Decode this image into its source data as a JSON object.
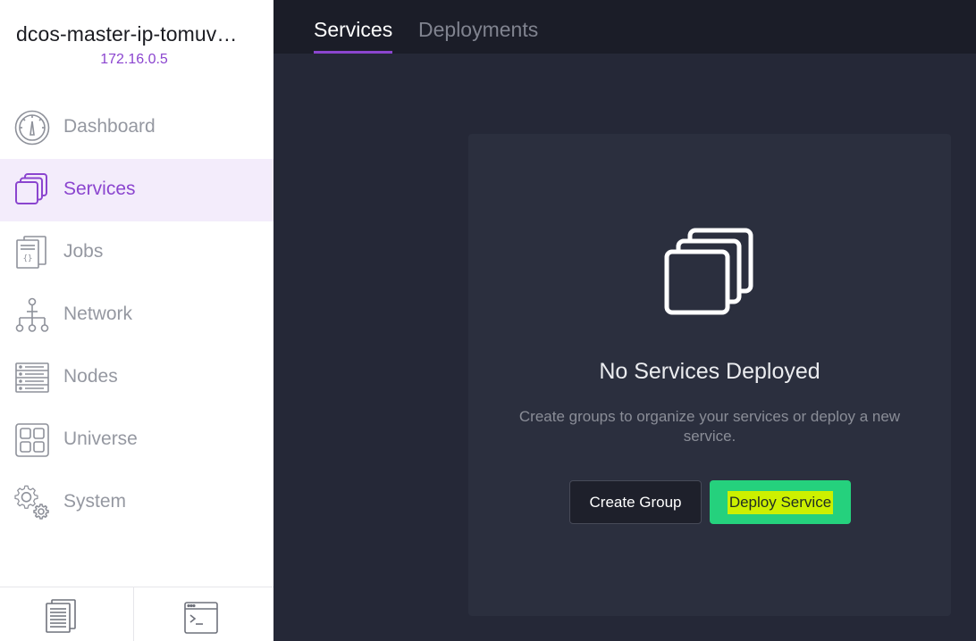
{
  "cluster": {
    "name": "dcos-master-ip-tomuv…",
    "ip": "172.16.0.5"
  },
  "sidebar": {
    "items": [
      {
        "label": "Dashboard",
        "icon": "dashboard-icon",
        "active": false
      },
      {
        "label": "Services",
        "icon": "services-icon",
        "active": true
      },
      {
        "label": "Jobs",
        "icon": "jobs-icon",
        "active": false
      },
      {
        "label": "Network",
        "icon": "network-icon",
        "active": false
      },
      {
        "label": "Nodes",
        "icon": "nodes-icon",
        "active": false
      },
      {
        "label": "Universe",
        "icon": "universe-icon",
        "active": false
      },
      {
        "label": "System",
        "icon": "system-icon",
        "active": false
      }
    ],
    "footer": [
      {
        "icon": "documentation-icon"
      },
      {
        "icon": "cli-terminal-icon"
      }
    ]
  },
  "tabs": [
    {
      "label": "Services",
      "active": true
    },
    {
      "label": "Deployments",
      "active": false
    }
  ],
  "empty_state": {
    "icon": "services-stack-icon",
    "title": "No Services Deployed",
    "description": "Create groups to organize your services or deploy a new service.",
    "create_group_label": "Create Group",
    "deploy_service_label": "Deploy Service"
  },
  "colors": {
    "accent": "#8b45cf",
    "active_bg": "#f3ecfb",
    "sidebar_text": "#9598a1",
    "main_bg": "#252837",
    "tabbar_bg": "#1b1d28",
    "card_bg": "#2b2f3e",
    "deploy_green": "#25d17d",
    "deploy_highlight": "#ccf000"
  }
}
